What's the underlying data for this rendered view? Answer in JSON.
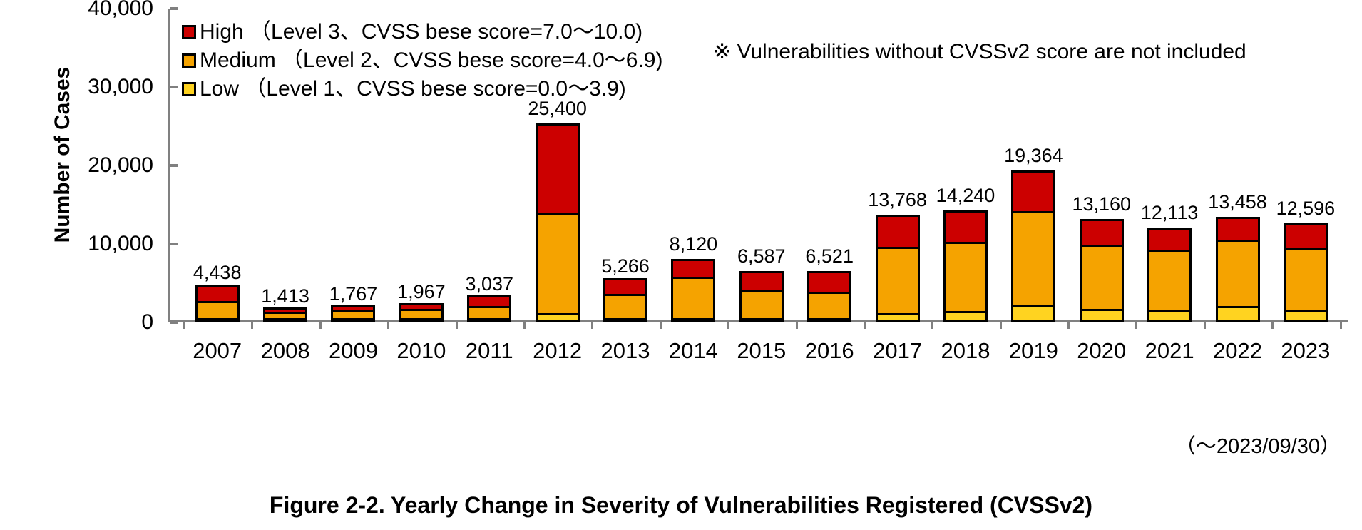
{
  "chart_data": {
    "type": "bar",
    "subtype": "stacked-bar",
    "title": "Figure 2-2. Yearly Change in Severity of Vulnerabilities Registered (CVSSv2)",
    "xlabel": "",
    "ylabel": "Number of Cases",
    "ylim": [
      0,
      40000
    ],
    "ytick_labels": [
      "40,000",
      "30,000",
      "20,000",
      "10,000",
      "0"
    ],
    "ytick_values": [
      40000,
      30000,
      20000,
      10000,
      0
    ],
    "grid": false,
    "legend_position": "top-left",
    "categories": [
      "2007",
      "2008",
      "2009",
      "2010",
      "2011",
      "2012",
      "2013",
      "2014",
      "2015",
      "2016",
      "2017",
      "2018",
      "2019",
      "2020",
      "2021",
      "2022",
      "2023"
    ],
    "series": [
      {
        "name": "Low",
        "color": "#FFD320",
        "values": [
          120,
          40,
          45,
          50,
          70,
          1150,
          180,
          560,
          570,
          580,
          1180,
          1420,
          2230,
          1750,
          1680,
          2060,
          1580
        ]
      },
      {
        "name": "Medium",
        "color": "#F5A300",
        "values": [
          2140,
          800,
          1030,
          1170,
          1560,
          12850,
          3110,
          5300,
          3550,
          3350,
          8500,
          8900,
          11950,
          8150,
          7580,
          8500,
          7980
        ]
      },
      {
        "name": "High",
        "color": "#CC0000",
        "values": [
          2178,
          573,
          692,
          747,
          1407,
          11400,
          1976,
          2260,
          2467,
          2591,
          4088,
          3920,
          5184,
          3260,
          2853,
          2898,
          3036
        ]
      }
    ],
    "total_labels": [
      "4,438",
      "1,413",
      "1,767",
      "1,967",
      "3,037",
      "25,400",
      "5,266",
      "8,120",
      "6,587",
      "6,521",
      "13,768",
      "14,240",
      "19,364",
      "13,160",
      "12,113",
      "13,458",
      "12,596"
    ],
    "totals": [
      4438,
      1413,
      1767,
      1967,
      3037,
      25400,
      5266,
      8120,
      6587,
      6521,
      13768,
      14240,
      19364,
      13160,
      12113,
      13458,
      12596
    ],
    "annotations": [
      "※ Vulnerabilities without CVSSv2 score are not included",
      "（～2023/09/30）"
    ]
  },
  "legend": {
    "items": [
      {
        "label": "High  （Level 3、CVSS bese score=7.0～10.0)",
        "color": "#CC0000"
      },
      {
        "label": "Medium  （Level 2、CVSS bese score=4.0～6.9)",
        "color": "#F5A300"
      },
      {
        "label": "Low  （Level 1、CVSS bese score=0.0～3.9)",
        "color": "#FFD320"
      }
    ]
  },
  "note": "※ Vulnerabilities without CVSSv2 score are not included",
  "footnote": "（～2023/09/30）",
  "caption": "Figure 2-2. Yearly Change in Severity of Vulnerabilities Registered (CVSSv2)",
  "axis": {
    "y_title": "Number of Cases"
  }
}
